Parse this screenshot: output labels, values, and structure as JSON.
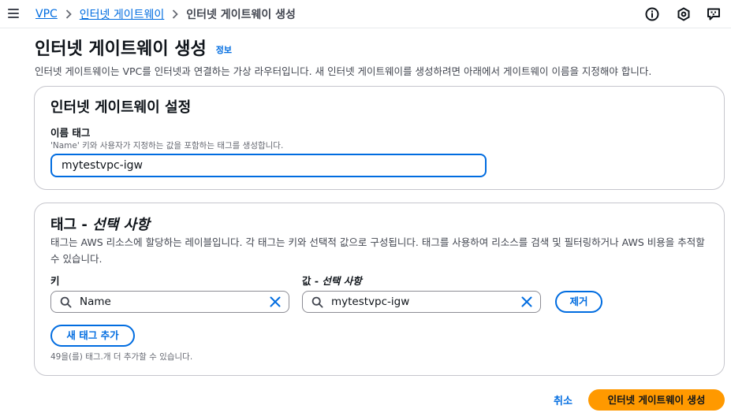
{
  "breadcrumbs": {
    "items": [
      "VPC",
      "인터넷 게이트웨이"
    ],
    "current": "인터넷 게이트웨이 생성"
  },
  "page": {
    "title": "인터넷 게이트웨이 생성",
    "info_link": "정보",
    "description": "인터넷 게이트웨이는 VPC를 인터넷과 연결하는 가상 라우터입니다. 새 인터넷 게이트웨이를 생성하려면 아래에서 게이트웨이 이름을 지정해야 합니다."
  },
  "settings": {
    "title": "인터넷 게이트웨이 설정",
    "name_tag_label": "이름 태그",
    "name_tag_desc": "'Name' 키와 사용자가 지정하는 값을 포함하는 태그를 생성합니다.",
    "name_tag_value": "mytestvpc-igw"
  },
  "tags": {
    "title_main": "태그 - ",
    "title_optional": "선택 사항",
    "description": "태그는 AWS 리소스에 할당하는 레이블입니다. 각 태그는 키와 선택적 값으로 구성됩니다. 태그를 사용하여 리소스를 검색 및 필터링하거나 AWS 비용을 추적할 수 있습니다.",
    "key_label": "키",
    "value_label_main": "값 - ",
    "value_label_optional": "선택 사항",
    "key_value": "Name",
    "value_value": "mytestvpc-igw",
    "remove_button": "제거",
    "add_button": "새 태그 추가",
    "limit_note": "49을(를) 태그.개 더 추가할 수 있습니다."
  },
  "footer": {
    "cancel": "취소",
    "create": "인터넷 게이트웨이 생성"
  },
  "icons": [
    "menu-icon",
    "info-icon",
    "notifications-icon",
    "feedback-icon",
    "search-icon",
    "clear-icon",
    "chevron-right-icon"
  ],
  "colors": {
    "link": "#006ce0",
    "primary_button": "#ff9900",
    "border": "#c6c6cd",
    "text": "#0f141a"
  }
}
